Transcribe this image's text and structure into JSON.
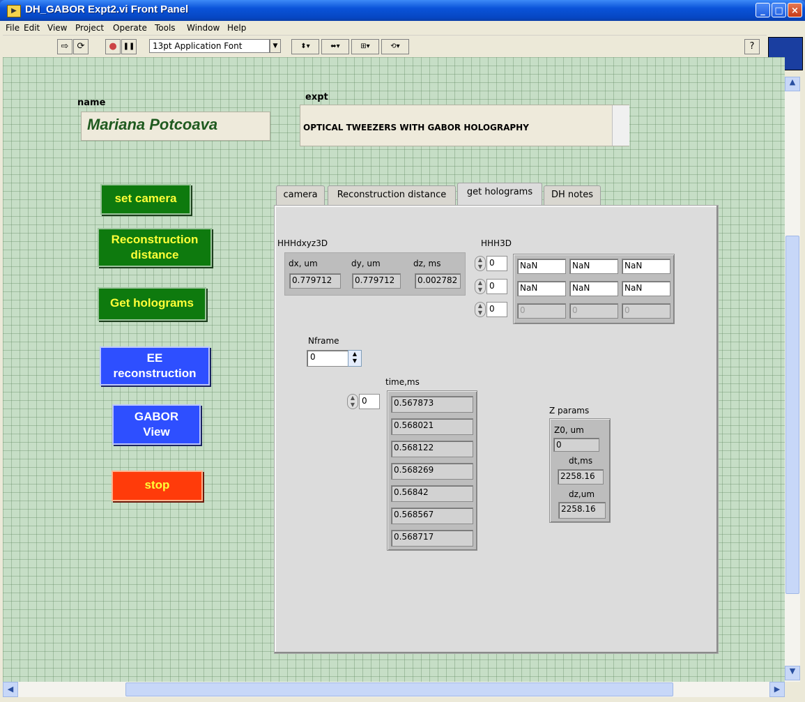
{
  "window": {
    "title": "DH_GABOR Expt2.vi Front Panel",
    "minimize": "_",
    "maximize": "□",
    "close": "×"
  },
  "menu": [
    "File",
    "Edit",
    "View",
    "Project",
    "Operate",
    "Tools",
    "Window",
    "Help"
  ],
  "toolbar": {
    "font": "13pt Application Font",
    "run_icon": "⇨",
    "run_continuous_icon": "⟳",
    "abort_icon": "●",
    "pause_icon": "❚❚",
    "help_icon": "?"
  },
  "name": {
    "label": "name",
    "value": "Mariana Potcoava"
  },
  "expt": {
    "label": "expt",
    "value": "OPTICAL TWEEZERS WITH GABOR HOLOGRAPHY"
  },
  "buttons": {
    "set_camera": "set camera",
    "reconstruction_distance": [
      "Reconstruction",
      "distance"
    ],
    "get_holograms": "Get holograms",
    "ee_reconstruction": [
      "EE",
      "reconstruction"
    ],
    "gabor_view": [
      "GABOR",
      "View"
    ],
    "stop": "stop"
  },
  "tabs": [
    "camera",
    "Reconstruction distance",
    "get holograms",
    "DH notes"
  ],
  "active_tab": "get holograms",
  "hhhdxyz3d": {
    "label": "HHHdxyz3D",
    "fields": [
      {
        "label": "dx, um",
        "value": "0.779712"
      },
      {
        "label": "dy, um",
        "value": "0.779712"
      },
      {
        "label": "dz, ms",
        "value": "0.002782"
      }
    ]
  },
  "hhh3d": {
    "label": "HHH3D",
    "indices": [
      "0",
      "0",
      "0"
    ],
    "rows": [
      [
        "NaN",
        "NaN",
        "NaN"
      ],
      [
        "NaN",
        "NaN",
        "NaN"
      ],
      [
        "0",
        "0",
        "0"
      ]
    ]
  },
  "nframe": {
    "label": "Nframe",
    "value": "0"
  },
  "time_ms": {
    "label": "time,ms",
    "index": "0",
    "values": [
      "0.567873",
      "0.568021",
      "0.568122",
      "0.568269",
      "0.56842",
      "0.568567",
      "0.568717"
    ]
  },
  "z_params": {
    "label": "Z params",
    "z0_label": "Z0, um",
    "z0_value": "0",
    "dt_label": "dt,ms",
    "dt_value": "2258.16",
    "dz_label": "dz,um",
    "dz_value": "2258.16"
  },
  "colors": {
    "green_button": "#0e7a0e",
    "blue_button": "#2e4fff",
    "red_button": "#ff3b0a",
    "panel_grid": "#c6dec6"
  }
}
